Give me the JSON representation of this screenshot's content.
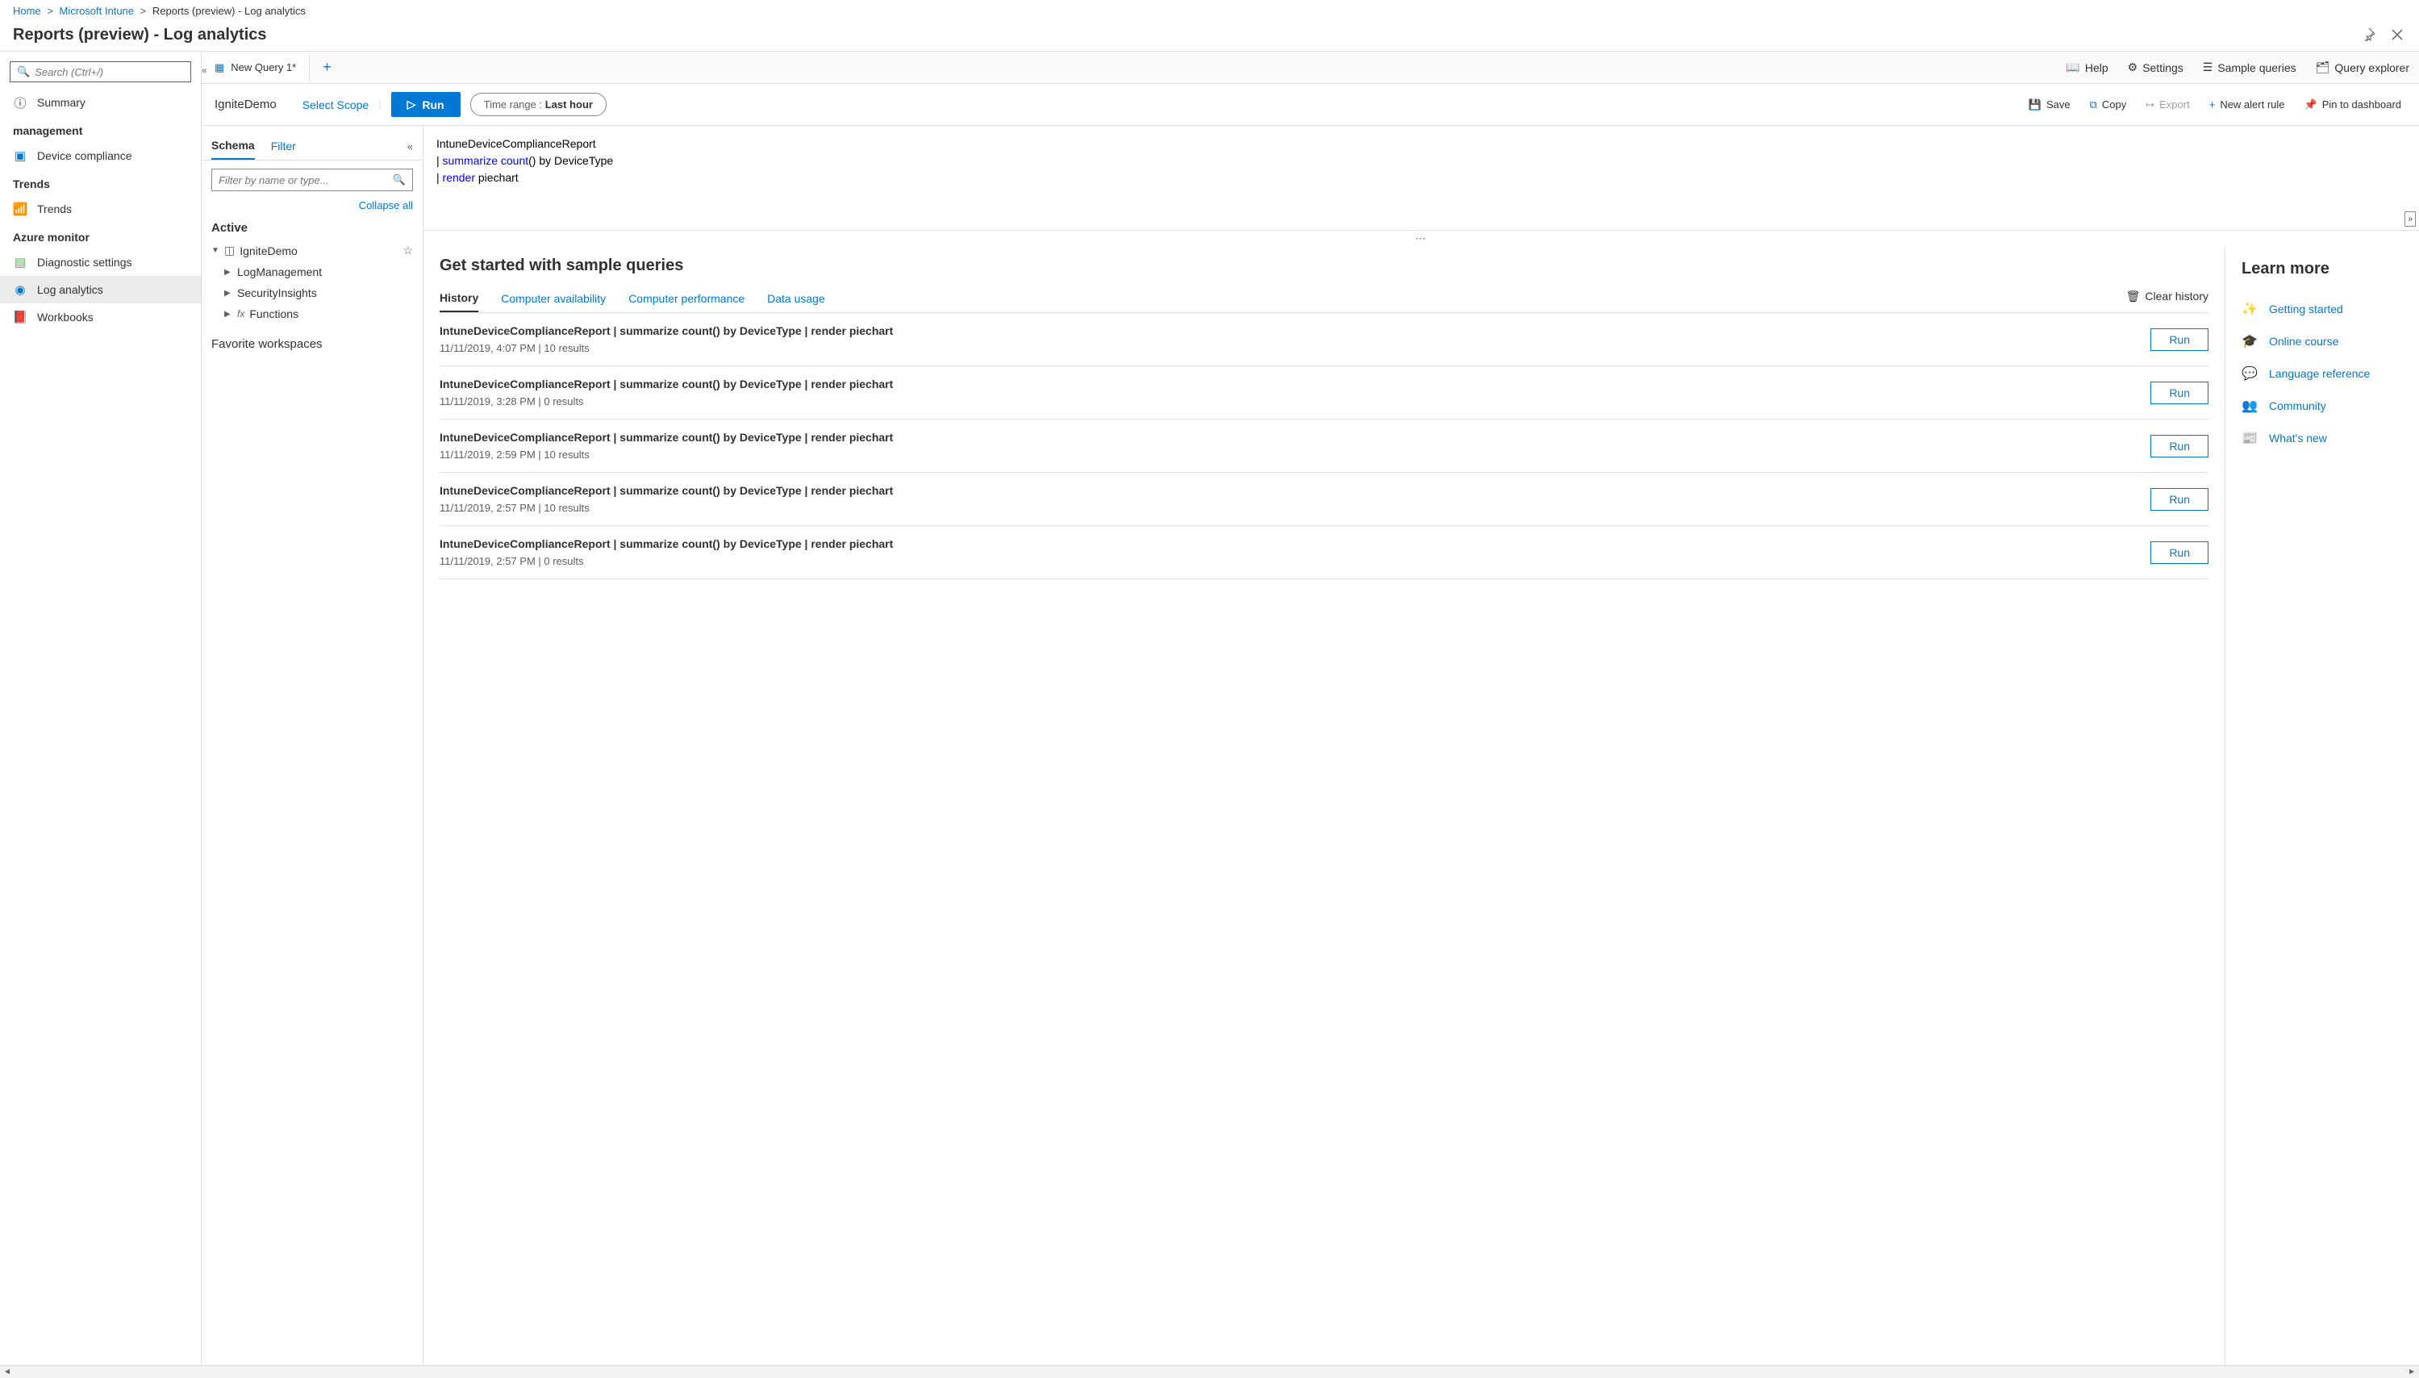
{
  "breadcrumb": {
    "home": "Home",
    "intune": "Microsoft Intune",
    "current": "Reports (preview) - Log analytics"
  },
  "page_title": "Reports (preview) - Log analytics",
  "sidebar": {
    "search_placeholder": "Search (Ctrl+/)",
    "groups": [
      {
        "title": "",
        "items": [
          {
            "icon": "ⓘ",
            "label": "Summary",
            "active": false
          }
        ]
      },
      {
        "title": "management",
        "items": [
          {
            "icon": "🛡",
            "label": "Device compliance",
            "active": false
          }
        ]
      },
      {
        "title": "Trends",
        "items": [
          {
            "icon": "📊",
            "label": "Trends",
            "active": false
          }
        ]
      },
      {
        "title": "Azure monitor",
        "items": [
          {
            "icon": "⚙",
            "label": "Diagnostic settings",
            "active": false
          },
          {
            "icon": "📘",
            "label": "Log analytics",
            "active": true
          },
          {
            "icon": "📓",
            "label": "Workbooks",
            "active": false
          }
        ]
      }
    ]
  },
  "tabs": {
    "new_query": "New Query 1*"
  },
  "tab_actions": {
    "help": "Help",
    "settings": "Settings",
    "sample_queries": "Sample queries",
    "query_explorer": "Query explorer"
  },
  "toolbar": {
    "workspace": "IgniteDemo",
    "select_scope": "Select Scope",
    "run": "Run",
    "time_label": "Time range : ",
    "time_value": "Last hour",
    "save": "Save",
    "copy": "Copy",
    "export": "Export",
    "new_alert": "New alert rule",
    "pin": "Pin to dashboard"
  },
  "schema": {
    "tab_schema": "Schema",
    "tab_filter": "Filter",
    "filter_placeholder": "Filter by name or type...",
    "collapse_all": "Collapse all",
    "active": "Active",
    "workspace": "IgniteDemo",
    "items": [
      {
        "label": "LogManagement"
      },
      {
        "label": "SecurityInsights"
      },
      {
        "label": "Functions",
        "fx": true
      }
    ],
    "favorite": "Favorite workspaces"
  },
  "code": {
    "l1": "IntuneDeviceComplianceReport",
    "l2_pipe": "| ",
    "l2_kw": "summarize",
    "l2_fn": " count",
    "l2_rest": "() by DeviceType",
    "l3_pipe": "| ",
    "l3_kw": "render",
    "l3_rest": " piechart"
  },
  "results": {
    "title": "Get started with sample queries",
    "tabs": {
      "history": "History",
      "availability": "Computer availability",
      "performance": "Computer performance",
      "data_usage": "Data usage"
    },
    "clear_history": "Clear history",
    "items": [
      {
        "query": "IntuneDeviceComplianceReport | summarize count() by DeviceType | render piechart",
        "meta": "11/11/2019, 4:07 PM | 10 results",
        "run": "Run"
      },
      {
        "query": "IntuneDeviceComplianceReport | summarize count() by DeviceType | render piechart",
        "meta": "11/11/2019, 3:28 PM | 0 results",
        "run": "Run"
      },
      {
        "query": "IntuneDeviceComplianceReport | summarize count() by DeviceType | render piechart",
        "meta": "11/11/2019, 2:59 PM | 10 results",
        "run": "Run"
      },
      {
        "query": "IntuneDeviceComplianceReport | summarize count() by DeviceType | render piechart",
        "meta": "11/11/2019, 2:57 PM | 10 results",
        "run": "Run"
      },
      {
        "query": "IntuneDeviceComplianceReport | summarize count() by DeviceType | render piechart",
        "meta": "11/11/2019, 2:57 PM | 0 results",
        "run": "Run"
      }
    ]
  },
  "learn": {
    "title": "Learn more",
    "items": [
      {
        "icon": "✨",
        "label": "Getting started"
      },
      {
        "icon": "🎓",
        "label": "Online course"
      },
      {
        "icon": "💬",
        "label": "Language reference"
      },
      {
        "icon": "👥",
        "label": "Community"
      },
      {
        "icon": "📰",
        "label": "What's new"
      }
    ]
  }
}
